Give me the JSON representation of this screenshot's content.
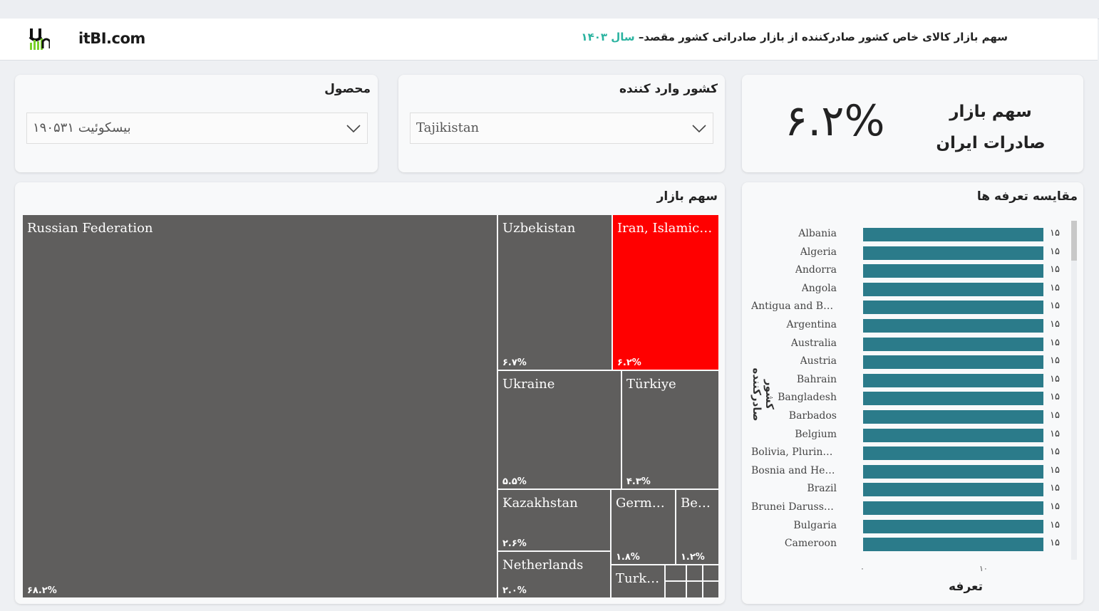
{
  "header": {
    "logo_text": "itBI.com",
    "title_main": "سهم بازار کالای خاص کشور صادرکننده از بازار صادراتی کشور مقصد–",
    "title_year": " سال ۱۴۰۳"
  },
  "filters": {
    "product_label": "محصول",
    "product_value": "بیسکوئیت ۱۹۰۵۳۱",
    "importer_label": "کشور وارد کننده",
    "importer_value": "Tajikistan"
  },
  "kpi": {
    "label": "سهم بازار صادرات ایران",
    "value": "۶.۲%"
  },
  "market_share": {
    "title": "سهم بازار",
    "tiles": [
      {
        "name": "Russian Federation",
        "pct": "۶۸.۲%",
        "highlight": false
      },
      {
        "name": "Uzbekistan",
        "pct": "۶.۷%",
        "highlight": false
      },
      {
        "name": "Iran, Islamic Republic of",
        "pct": "۶.۲%",
        "highlight": true
      },
      {
        "name": "Ukraine",
        "pct": "۵.۵%",
        "highlight": false
      },
      {
        "name": "Türkiye",
        "pct": "۴.۳%",
        "highlight": false
      },
      {
        "name": "Kazakhstan",
        "pct": "۲.۶%",
        "highlight": false
      },
      {
        "name": "Germany",
        "pct": "۱.۸%",
        "highlight": false
      },
      {
        "name": "Belarus",
        "pct": "۱.۲%",
        "highlight": false
      },
      {
        "name": "Netherlands",
        "pct": "۲.۰%",
        "highlight": false
      },
      {
        "name": "Turkmenistan",
        "pct": "",
        "highlight": false
      }
    ],
    "colors": {
      "base": "#5f5e5d",
      "highlight": "#ff0000"
    }
  },
  "tariffs": {
    "title": "مقایسه تعرفه ها",
    "y_axis_label": "کشور صادرکننده",
    "x_axis_label": "تعرفه",
    "x_ticks": [
      "۰",
      "۱۰"
    ],
    "bar_color": "#2b7b8a"
  },
  "chart_data": {
    "type": "bar",
    "orientation": "horizontal",
    "title": "مقایسه تعرفه ها",
    "xlabel": "تعرفه",
    "ylabel": "کشور صادرکننده",
    "categories": [
      "Albania",
      "Algeria",
      "Andorra",
      "Angola",
      "Antigua and Barbuda",
      "Argentina",
      "Australia",
      "Austria",
      "Bahrain",
      "Bangladesh",
      "Barbados",
      "Belgium",
      "Bolivia, Plurinational State of",
      "Bosnia and Herzegovina",
      "Brazil",
      "Brunei Darussalam",
      "Bulgaria",
      "Cameroon"
    ],
    "values": [
      15,
      15,
      15,
      15,
      15,
      15,
      15,
      15,
      15,
      15,
      15,
      15,
      15,
      15,
      15,
      15,
      15,
      15
    ],
    "value_labels": [
      "۱۵",
      "۱۵",
      "۱۵",
      "۱۵",
      "۱۵",
      "۱۵",
      "۱۵",
      "۱۵",
      "۱۵",
      "۱۵",
      "۱۵",
      "۱۵",
      "۱۵",
      "۱۵",
      "۱۵",
      "۱۵",
      "۱۵",
      "۱۵"
    ],
    "xlim": [
      0,
      15
    ]
  }
}
